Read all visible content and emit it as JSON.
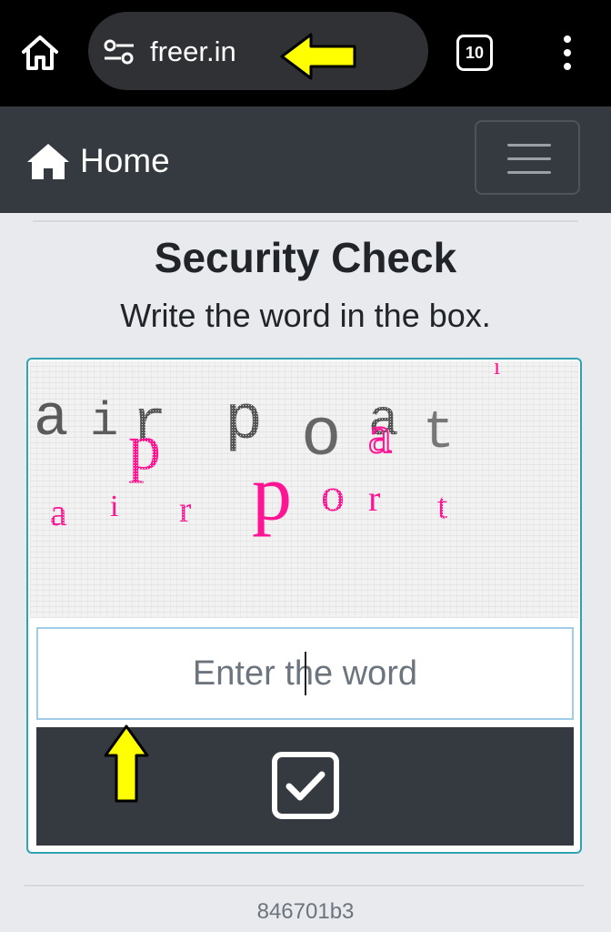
{
  "browser": {
    "url": "freer.in",
    "tab_count": "10"
  },
  "nav": {
    "home_label": "Home"
  },
  "page": {
    "title": "Security Check",
    "subtitle": "Write the word in the box."
  },
  "captcha": {
    "word_top": "airpot",
    "word_bottom": "airport",
    "input_placeholder": "Enter the word",
    "input_value": ""
  },
  "footer": {
    "code": "846701b3"
  },
  "colors": {
    "annotation_arrow": "#ffff00",
    "navbar": "#343a40",
    "card_border": "#2fa3b2",
    "captcha_pink": "#ff1493"
  },
  "icons": {
    "browser_home": "home-outline-icon",
    "site_settings": "tune-icon",
    "tabs": "tab-switcher-icon",
    "menu": "kebab-menu-icon",
    "nav_home": "home-solid-icon",
    "toggler": "hamburger-icon",
    "submit": "checkbox-checked-icon",
    "annotation": "arrow-icon"
  }
}
